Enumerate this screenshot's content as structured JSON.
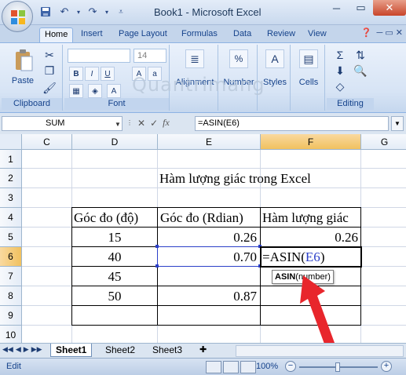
{
  "window": {
    "title": "Book1 - Microsoft Excel",
    "minimize": "─",
    "maximize": "▭",
    "close": "✕"
  },
  "quick_access": {
    "save_icon": "save-icon",
    "undo_icon": "undo-icon",
    "redo_icon": "redo-icon",
    "customize_icon": "dropdown-icon"
  },
  "tabs": [
    {
      "label": "Home",
      "active": true
    },
    {
      "label": "Insert"
    },
    {
      "label": "Page Layout"
    },
    {
      "label": "Formulas"
    },
    {
      "label": "Data"
    },
    {
      "label": "Review"
    },
    {
      "label": "View"
    }
  ],
  "ribbon": {
    "clipboard": {
      "paste_label": "Paste",
      "group_label": "Clipboard"
    },
    "font": {
      "font_size": "14",
      "group_label": "Font",
      "bold": "B",
      "italic": "I",
      "underline": "U"
    },
    "alignment_label": "Alignment",
    "number_label": "Number",
    "number_symbol": "%",
    "styles_label": "Styles",
    "cells_label": "Cells",
    "editing_label": "Editing",
    "sigma": "Σ"
  },
  "watermark": "Quantrimang",
  "formula_bar": {
    "name_box": "SUM",
    "cancel": "✕",
    "enter": "✓",
    "fx": "fx",
    "formula": "=ASIN(E6)"
  },
  "columns": [
    "C",
    "D",
    "E",
    "F",
    "G"
  ],
  "rows": [
    "1",
    "2",
    "3",
    "4",
    "5",
    "6",
    "7",
    "8",
    "9",
    "10"
  ],
  "cells": {
    "title": "Hàm lượng giác trong Excel",
    "headers": [
      "Góc đo (độ)",
      "Góc đo (Rdian)",
      "Hàm lượng giác"
    ],
    "d5": "15",
    "e5": "0.26",
    "f5": "0.26",
    "d6": "40",
    "e6": "0.70",
    "f6_prefix": "=ASIN(",
    "f6_ref": "E6",
    "f6_suffix": ")",
    "d7": "45",
    "d8": "50",
    "e8": "0.87"
  },
  "tooltip": {
    "bold": "ASIN",
    "rest": "(number)"
  },
  "sheet_tabs": [
    "Sheet1",
    "Sheet2",
    "Sheet3"
  ],
  "status": {
    "mode": "Edit",
    "zoom": "100%",
    "zoom_fraction": 0.5
  },
  "colors": {
    "accent": "#15428b",
    "ref_blue": "#2b3fc8",
    "arrow_red": "#e8262c"
  }
}
